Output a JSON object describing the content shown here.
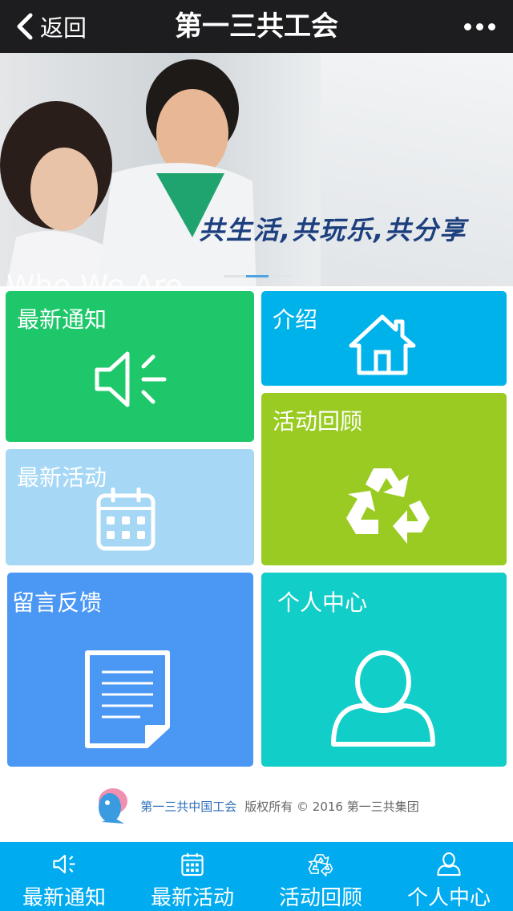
{
  "header": {
    "back_label": "返回",
    "title": "第一三共工会",
    "more_icon": "more-dots-icon"
  },
  "banner": {
    "slogan": "共生活,共玩乐,共分享",
    "tagline": "Who We Are",
    "slide_count": 3,
    "active_slide": 2
  },
  "tiles": {
    "notice": {
      "label": "最新通知",
      "icon": "speaker-icon",
      "color": "#1ec86a"
    },
    "intro": {
      "label": "介绍",
      "icon": "house-icon",
      "color": "#00b2ea"
    },
    "review": {
      "label": "活动回顾",
      "icon": "recycle-icon",
      "color": "#99cb22"
    },
    "activity": {
      "label": "最新活动",
      "icon": "calendar-icon",
      "color": "#a6d8f6"
    },
    "feedback": {
      "label": "留言反馈",
      "icon": "document-icon",
      "color": "#4b98f4"
    },
    "personal": {
      "label": "个人中心",
      "icon": "user-icon",
      "color": "#12cec8"
    }
  },
  "footer": {
    "org": "第一三共中国工会",
    "copyright": "版权所有 © 2016  第一三共集团"
  },
  "tabbar": {
    "color": "#00acef",
    "items": [
      {
        "label": "最新通知",
        "icon": "speaker-icon"
      },
      {
        "label": "最新活动",
        "icon": "calendar-icon"
      },
      {
        "label": "活动回顾",
        "icon": "recycle-icon"
      },
      {
        "label": "个人中心",
        "icon": "user-icon"
      }
    ]
  }
}
